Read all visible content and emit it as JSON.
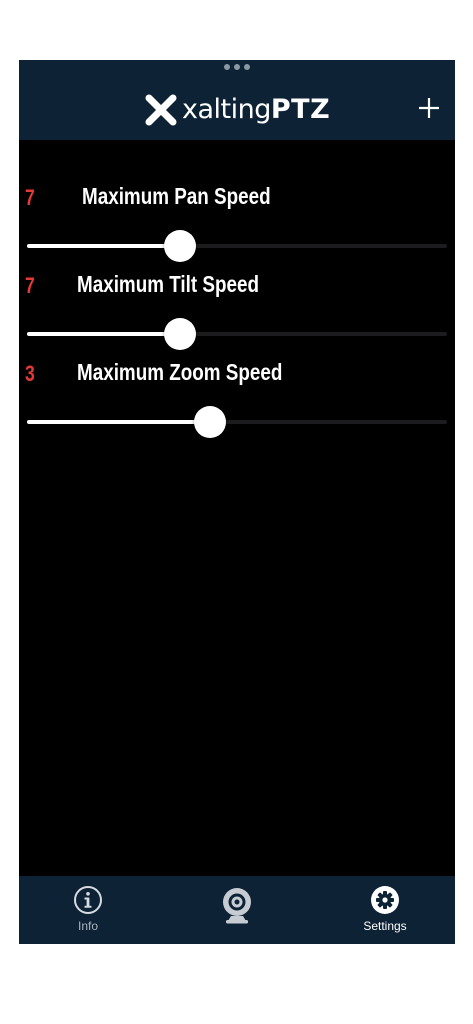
{
  "header": {
    "logo_text_light": "xalting",
    "logo_text_bold": "PTZ",
    "add_label": "+"
  },
  "settings": [
    {
      "label": "Maximum Pan Speed",
      "value": "7",
      "level": 0.365
    },
    {
      "label": "Maximum Tilt Speed",
      "value": "7",
      "level": 0.365
    },
    {
      "label": "Maximum Zoom Speed",
      "value": "3",
      "level": 0.435
    }
  ],
  "tabbar": {
    "tabs": [
      {
        "label": "Info",
        "icon": "info-icon",
        "active": false
      },
      {
        "label": "",
        "icon": "webcam-icon",
        "active": false
      },
      {
        "label": "Settings",
        "icon": "gear-icon",
        "active": true
      }
    ]
  },
  "colors": {
    "header_bg": "#0d2235",
    "content_bg": "#000000",
    "value_red": "#e53935",
    "tab_inactive": "#a9b3bd"
  }
}
